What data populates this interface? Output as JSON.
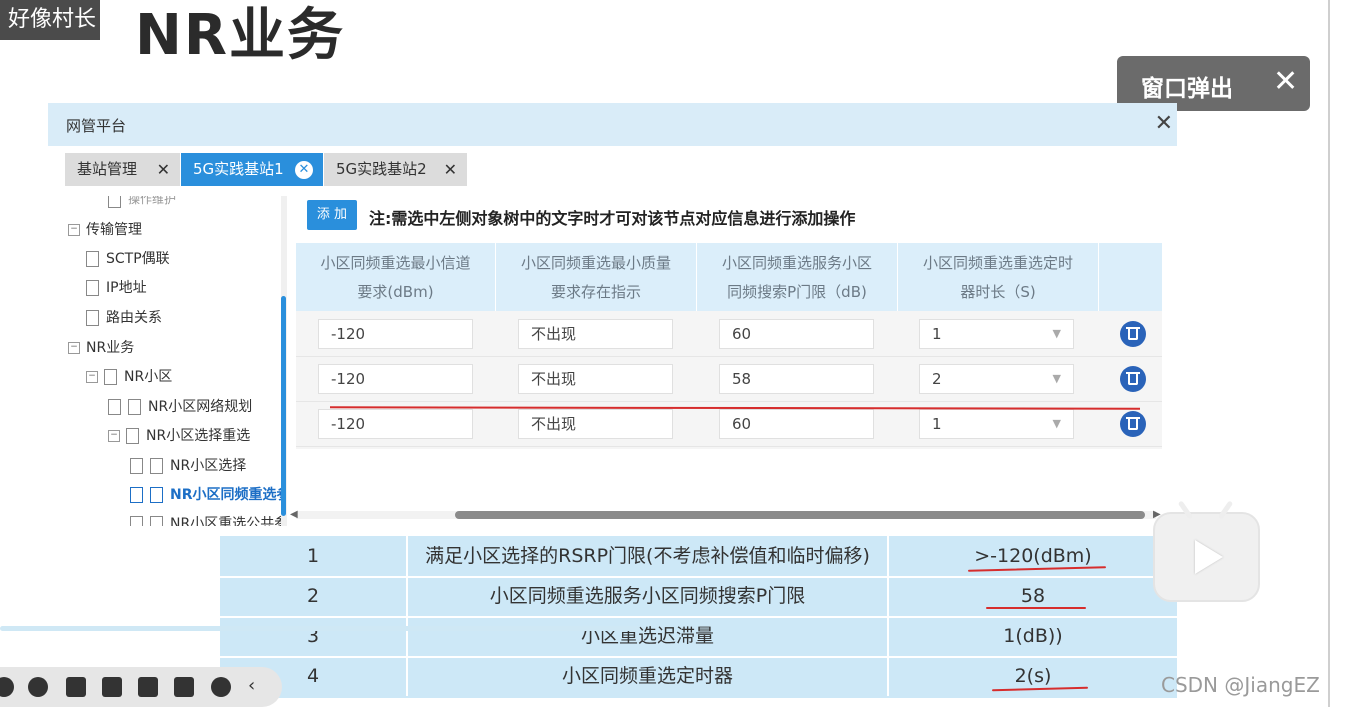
{
  "slide": {
    "title": "NR业务",
    "watermark": "好像村长",
    "credit": "CSDN @JiangEZ"
  },
  "popup": {
    "label": "窗口弹出",
    "close": "✕"
  },
  "window": {
    "title": "网管平台",
    "close": "✕"
  },
  "tabs": [
    {
      "label": "基站管理",
      "close": "✕"
    },
    {
      "label": "5G实践基站1",
      "close": "✕"
    },
    {
      "label": "5G实践基站2",
      "close": "✕"
    }
  ],
  "tree": {
    "cut_item": "操作维护",
    "transport": "传输管理",
    "sctp": "SCTP偶联",
    "ip": "IP地址",
    "route": "路由关系",
    "nr_service": "NR业务",
    "nr_cell": "NR小区",
    "nr_net_plan": "NR小区网络规划",
    "nr_sel_resel": "NR小区选择重选",
    "nr_select": "NR小区选择",
    "nr_intra_resel": "NR小区同频重选参",
    "nr_resel_common": "NR小区重选公共参"
  },
  "toolbar": {
    "add": "添 加",
    "note": "注:需选中左侧对象树中的文字时才可对该节点对应信息进行添加操作"
  },
  "grid": {
    "headers": [
      [
        "小区同频重选最小信道",
        "要求(dBm)"
      ],
      [
        "小区同频重选最小质量",
        "要求存在指示"
      ],
      [
        "小区同频重选服务小区",
        "同频搜索P门限（dB)"
      ],
      [
        "小区同频重选重选定时",
        "器时长（S)"
      ]
    ],
    "rows": [
      {
        "min_rx": "-120",
        "min_qual": "不出现",
        "s_intra": "60",
        "timer": "1"
      },
      {
        "min_rx": "-120",
        "min_qual": "不出现",
        "s_intra": "58",
        "timer": "2"
      },
      {
        "min_rx": "-120",
        "min_qual": "不出现",
        "s_intra": "60",
        "timer": "1"
      }
    ]
  },
  "ref_table": [
    {
      "no": "1",
      "param": "满足小区选择的RSRP门限(不考虑补偿值和临时偏移)",
      "value": ">-120(dBm)"
    },
    {
      "no": "2",
      "param": "小区同频重选服务小区同频搜索P门限",
      "value": "58"
    },
    {
      "no": "3",
      "param": "小区重选迟滞量",
      "value": "1(dB))"
    },
    {
      "no": "4",
      "param": "小区同频重选定时器",
      "value": "2(s)"
    }
  ],
  "colors": {
    "accent": "#2a8fdc",
    "header_bg": "#d9ecf8",
    "annotation_red": "#d62d2d",
    "table_bg": "#cde8f7"
  }
}
